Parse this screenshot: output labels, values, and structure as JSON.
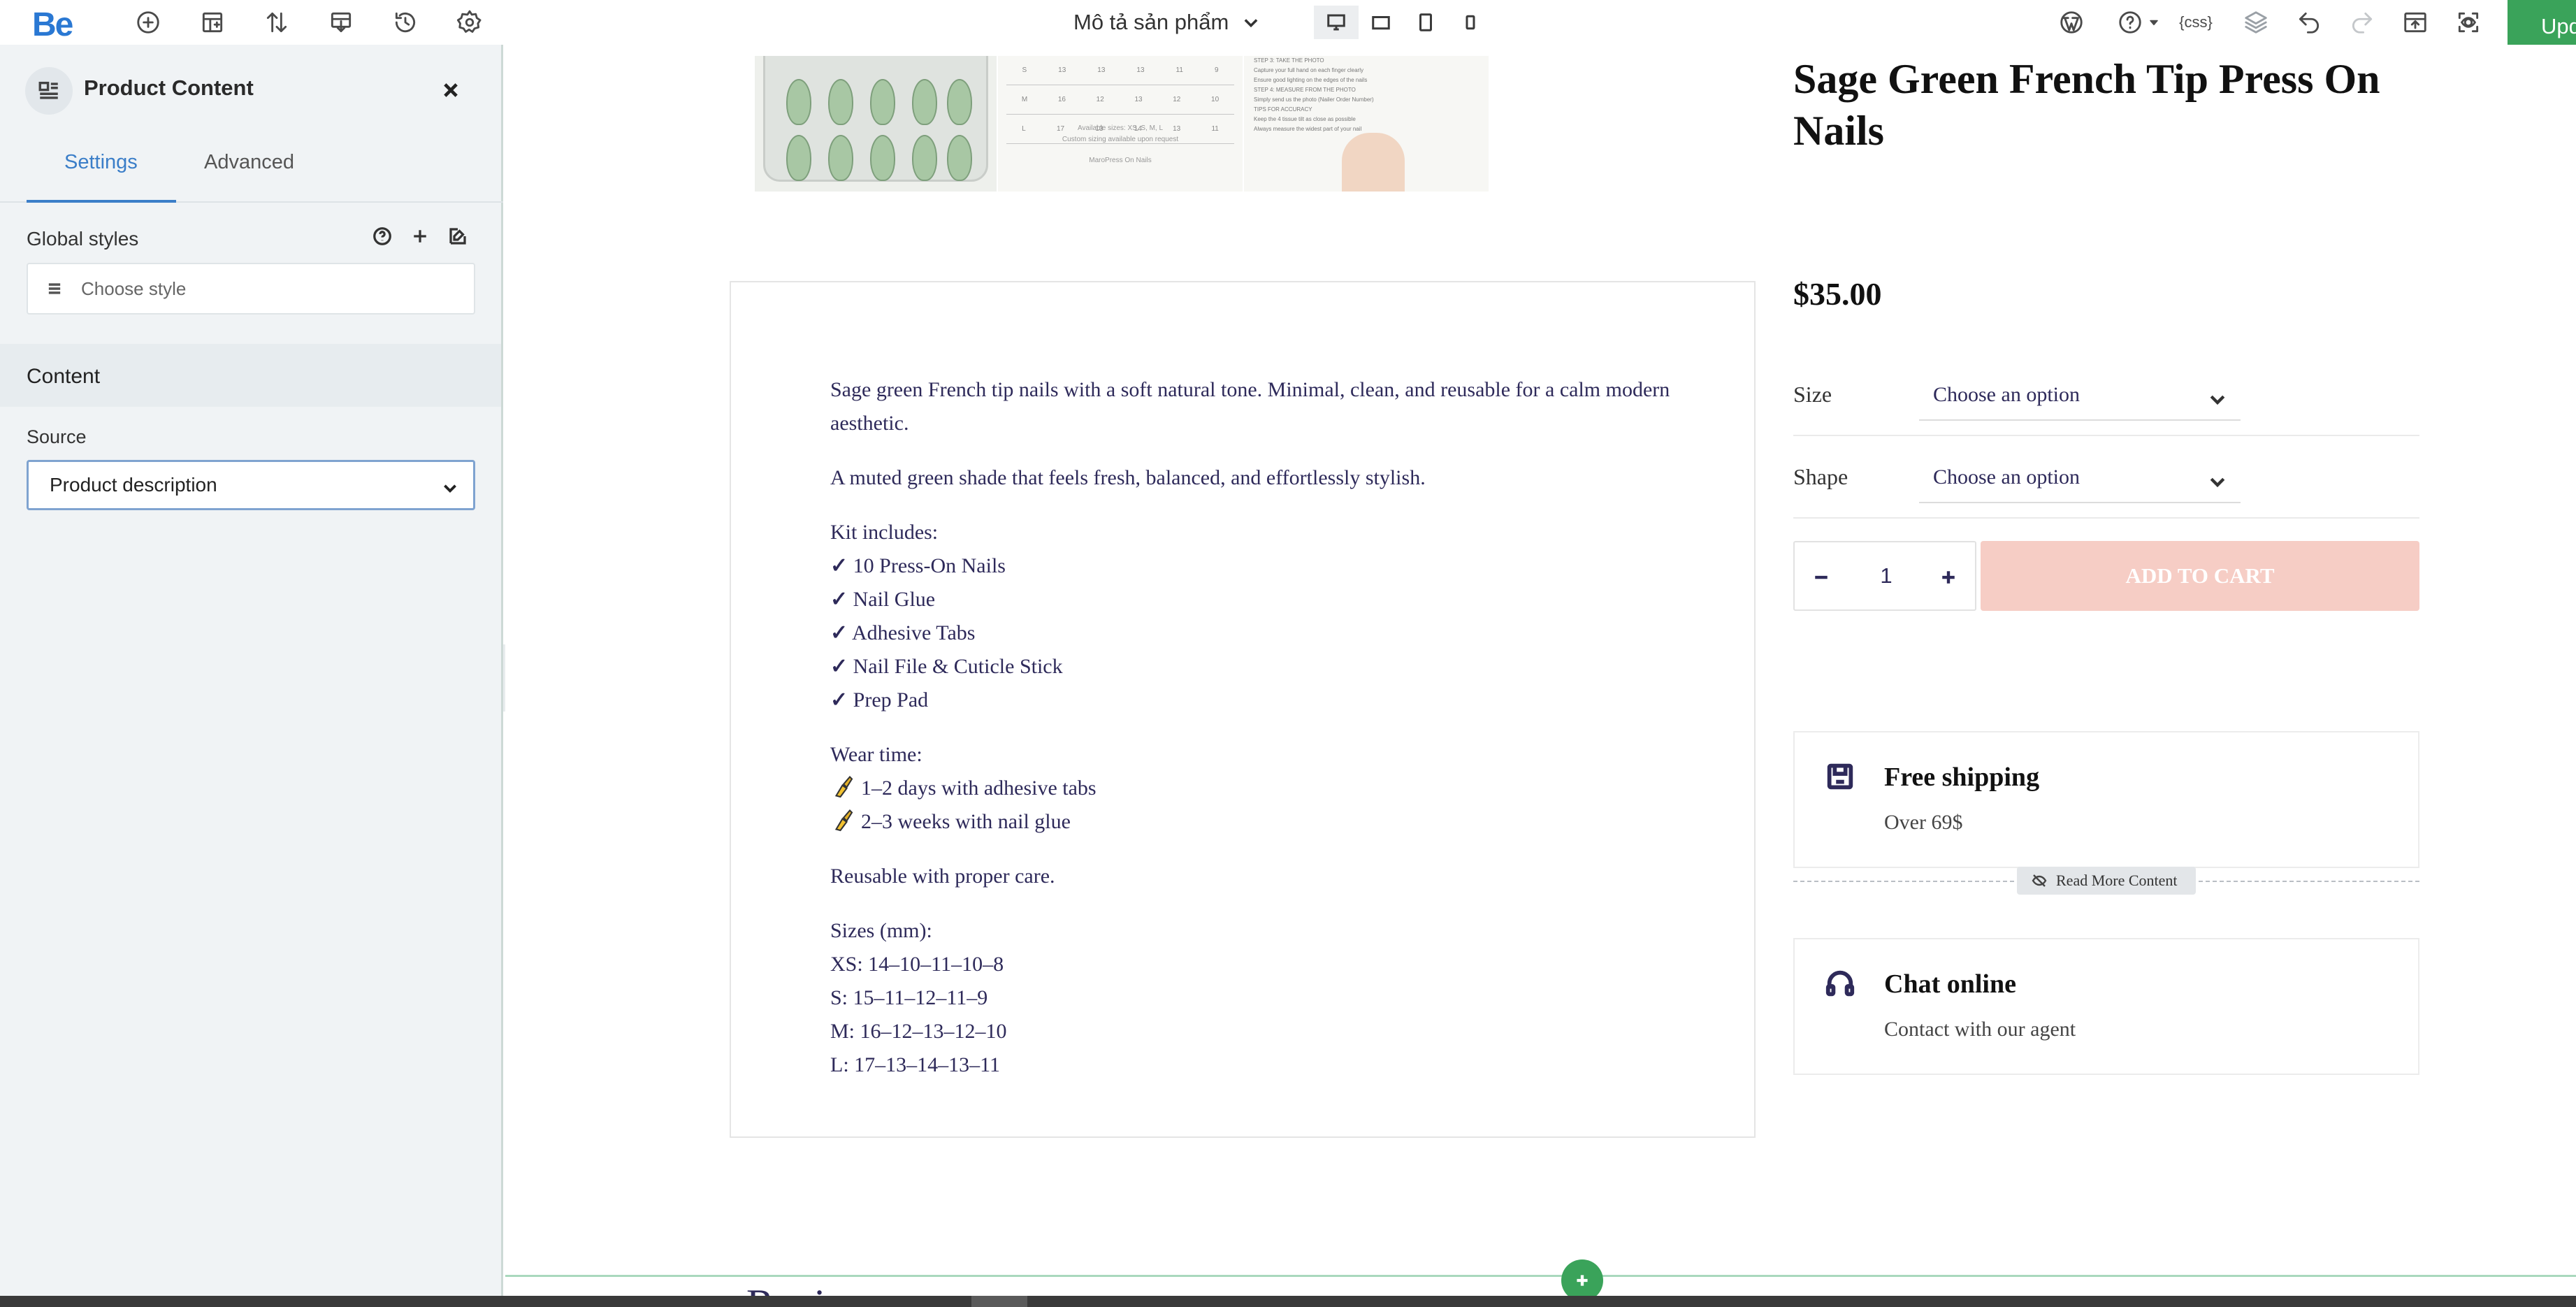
{
  "app": {
    "logo": "Be",
    "update_label": "Upd"
  },
  "toolbar": {
    "icons": [
      "add-icon",
      "layout-icon",
      "sort-icon",
      "import-icon",
      "history-icon",
      "settings-icon"
    ],
    "page_selector": "Mô tả sản phẩm",
    "devices": [
      "desktop",
      "tablet-landscape",
      "tablet-portrait",
      "mobile"
    ],
    "right_icons": [
      "wordpress-icon",
      "help-icon",
      "css-icon",
      "layers-icon",
      "undo-icon",
      "redo-icon",
      "export-icon",
      "preview-icon"
    ],
    "css_label": "{css}"
  },
  "panel": {
    "title": "Product Content",
    "tabs": {
      "settings": "Settings",
      "advanced": "Advanced"
    },
    "global_styles_label": "Global styles",
    "choose_style_placeholder": "Choose style",
    "content_section": "Content",
    "source_label": "Source",
    "source_value": "Product description"
  },
  "product": {
    "title": "Sage Green French Tip Press On Nails",
    "price": "$35.00",
    "variations": [
      {
        "label": "Size",
        "value": "Choose an option"
      },
      {
        "label": "Shape",
        "value": "Choose an option"
      }
    ],
    "quantity": "1",
    "add_to_cart": "ADD TO CART"
  },
  "description": {
    "p1": "Sage green French tip nails with a soft natural tone. Minimal, clean, and reusable for a calm modern aesthetic.",
    "p2": "A muted green shade that feels fresh, balanced, and effortlessly stylish.",
    "kit_title": "Kit includes:",
    "kit_items": [
      "10 Press-On Nails",
      "Nail Glue",
      "Adhesive Tabs",
      "Nail File & Cuticle Stick",
      "Prep Pad"
    ],
    "check": "✓",
    "wear_title": "Wear time:",
    "wear_items": [
      "1–2 days with adhesive tabs",
      "2–3 weeks with nail glue"
    ],
    "reusable": "Reusable with proper care.",
    "sizes_title": "Sizes (mm):",
    "sizes": [
      "XS: 14–10–11–10–8",
      "S: 15–11–12–11–9",
      "M: 16–12–13–12–10",
      "L: 17–13–14–13–11"
    ]
  },
  "gallery": {
    "size_note_1": "Available sizes: XS, S, M, L",
    "size_note_2": "Custom sizing available upon request",
    "size_note_3": "MaroPress On Nails",
    "rows": [
      [
        "S",
        "13",
        "13",
        "13",
        "11",
        "9"
      ],
      [
        "M",
        "16",
        "12",
        "13",
        "12",
        "10"
      ],
      [
        "L",
        "17",
        "13",
        "14",
        "13",
        "11"
      ]
    ],
    "instructions": [
      "STEP 3: TAKE THE PHOTO",
      "Capture your full hand on each finger clearly",
      "Ensure good lighting on the edges of the nails",
      "STEP 4: MEASURE FROM THE PHOTO",
      "Simply send us the photo (Nailer Order Number)",
      "TIPS FOR ACCURACY",
      "Keep the 4 tissue tilt as close as possible",
      "Always measure the widest part of your nail"
    ]
  },
  "features": {
    "shipping_title": "Free shipping",
    "shipping_sub": "Over 69$",
    "read_more": "Read More Content",
    "chat_title": "Chat online",
    "chat_sub": "Contact with our agent"
  },
  "reviews_peek": "Reviews",
  "colors": {
    "accent": "#3b7ec8",
    "brand_logo": "#2a78d3",
    "add_green": "#3aa35a",
    "cart_button": "#f6cdc5",
    "text_dark": "#2e2a5a"
  }
}
